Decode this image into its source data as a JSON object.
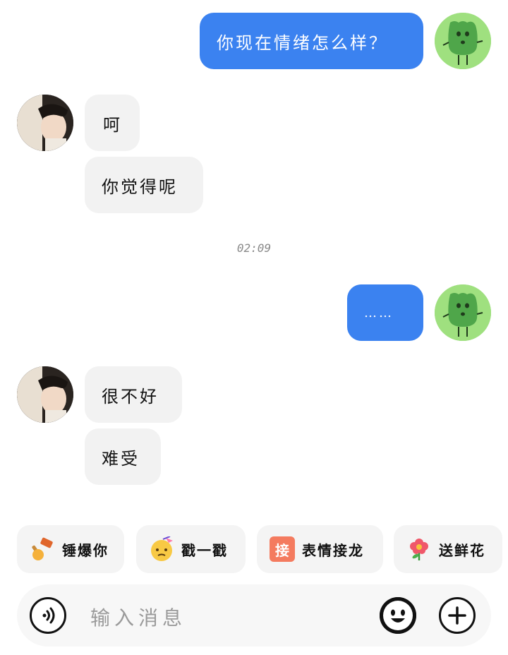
{
  "messages": [
    {
      "from": "me",
      "text": "你现在情绪怎么样？"
    },
    {
      "from": "them",
      "text": "呵"
    },
    {
      "from": "them",
      "text": "你觉得呢"
    },
    {
      "from": "me",
      "text": "……"
    },
    {
      "from": "them",
      "text": "很不好"
    },
    {
      "from": "them",
      "text": "难受"
    }
  ],
  "timestamp": "02:09",
  "quick_actions": [
    {
      "label": "锤爆你",
      "icon": "hammer-fist-icon"
    },
    {
      "label": "戳一戳",
      "icon": "poke-face-icon"
    },
    {
      "label": "表情接龙",
      "icon": "jie-badge-icon",
      "badge_char": "接"
    },
    {
      "label": "送鲜花",
      "icon": "flower-icon"
    }
  ],
  "input": {
    "placeholder": "输入消息"
  },
  "icons": {
    "voice": "voice-icon",
    "emoji": "emoji-icon",
    "plus": "plus-icon"
  },
  "colors": {
    "my_bubble": "#3b82f0",
    "their_bubble": "#f2f2f2",
    "my_avatar_bg": "#9fe07f",
    "badge": "#f47b5f"
  }
}
